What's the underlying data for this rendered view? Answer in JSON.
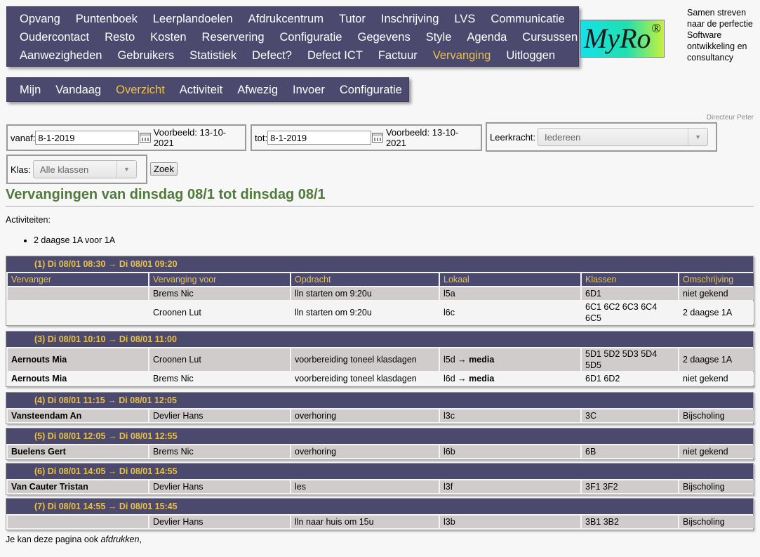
{
  "main_menu": [
    [
      "Opvang",
      "Puntenboek",
      "Leerplandoelen",
      "Afdrukcentrum",
      "Tutor",
      "Inschrijving",
      "LVS",
      "Communicatie"
    ],
    [
      "Oudercontact",
      "Resto",
      "Kosten",
      "Reservering",
      "Configuratie",
      "Gegevens",
      "Style",
      "Agenda",
      "Cursussen"
    ],
    [
      "Aanwezigheden",
      "Gebruikers",
      "Statistiek",
      "Defect?",
      "Defect ICT",
      "Factuur",
      "Vervanging",
      "Uitloggen"
    ]
  ],
  "sub_menu": [
    "Mijn",
    "Vandaag",
    "Overzicht",
    "Activiteit",
    "Afwezig",
    "Invoer",
    "Configuratie"
  ],
  "logo": {
    "text": "MyRo",
    "reg": "®"
  },
  "slogan": "Samen streven naar de perfectie Software ontwikkeling en consultancy",
  "user": "Directeur Peter",
  "filters": {
    "vanaf_label": "vanaf:",
    "vanaf_value": "8-1-2019",
    "vanaf_example": "Voorbeeld: 13-10-2021",
    "tot_label": "tot:",
    "tot_value": "8-1-2019",
    "tot_example": "Voorbeeld: 13-10-2021",
    "leerkracht_label": "Leerkracht:",
    "leerkracht_value": "Iedereen",
    "klas_label": "Klas:",
    "klas_value": "Alle klassen",
    "zoek": "Zoek"
  },
  "title": "Vervangingen van dinsdag 08/1 tot dinsdag 08/1",
  "activities_label": "Activiteiten:",
  "activities": [
    "2 daagse 1A voor 1A"
  ],
  "columns": [
    "Vervanger",
    "Vervanging voor",
    "Opdracht",
    "Lokaal",
    "Klassen",
    "Omschrijving"
  ],
  "blocks": [
    {
      "head": "(1) Di 08/01 08:30 → Di 08/01 09:20",
      "show_cols": true,
      "rows": [
        {
          "vervanger": "",
          "voor": "Brems Nic",
          "opdracht": "lln starten om 9:20u",
          "lokaal": "l5a",
          "lokaal_to": "",
          "klassen": "6D1",
          "omschrijving": "niet gekend"
        },
        {
          "vervanger": "",
          "voor": "Croonen Lut",
          "opdracht": "lln starten om 9:20u",
          "lokaal": "l6c",
          "lokaal_to": "",
          "klassen": "6C1 6C2 6C3 6C4 6C5",
          "omschrijving": "2 daagse 1A"
        }
      ]
    },
    {
      "head": "(3) Di 08/01 10:10 → Di 08/01 11:00",
      "show_cols": false,
      "rows": [
        {
          "vervanger": "Aernouts Mia",
          "voor": "Croonen Lut",
          "opdracht": "voorbereiding toneel klasdagen",
          "lokaal": "l5d → ",
          "lokaal_to": "media",
          "klassen": "5D1 5D2 5D3 5D4 5D5",
          "omschrijving": "2 daagse 1A"
        },
        {
          "vervanger": "Aernouts Mia",
          "voor": "Brems Nic",
          "opdracht": "voorbereiding toneel klasdagen",
          "lokaal": "l6d → ",
          "lokaal_to": "media",
          "klassen": "6D1 6D2",
          "omschrijving": "niet gekend"
        }
      ]
    },
    {
      "head": "(4) Di 08/01 11:15 → Di 08/01 12:05",
      "show_cols": false,
      "rows": [
        {
          "vervanger": "Vansteendam An",
          "voor": "Devlier Hans",
          "opdracht": "overhoring",
          "lokaal": "l3c",
          "lokaal_to": "",
          "klassen": "3C",
          "omschrijving": "Bijscholing"
        }
      ]
    },
    {
      "head": "(5) Di 08/01 12:05 → Di 08/01 12:55",
      "show_cols": false,
      "rows": [
        {
          "vervanger": "Buelens Gert",
          "voor": "Brems Nic",
          "opdracht": "overhoring",
          "lokaal": "l6b",
          "lokaal_to": "",
          "klassen": "6B",
          "omschrijving": "niet gekend"
        }
      ]
    },
    {
      "head": "(6) Di 08/01 14:05 → Di 08/01 14:55",
      "show_cols": false,
      "rows": [
        {
          "vervanger": "Van Cauter Tristan",
          "voor": "Devlier Hans",
          "opdracht": "les",
          "lokaal": "l3f",
          "lokaal_to": "",
          "klassen": "3F1 3F2",
          "omschrijving": "Bijscholing"
        }
      ]
    },
    {
      "head": "(7) Di 08/01 14:55 → Di 08/01 15:45",
      "show_cols": false,
      "rows": [
        {
          "vervanger": "",
          "voor": "Devlier Hans",
          "opdracht": "lln naar huis om 15u",
          "lokaal": "l3b",
          "lokaal_to": "",
          "klassen": "3B1 3B2",
          "omschrijving": "Bijscholing"
        }
      ]
    }
  ],
  "footer": {
    "text": "Je kan deze pagina ook ",
    "link": "afdrukken",
    "after": ","
  }
}
